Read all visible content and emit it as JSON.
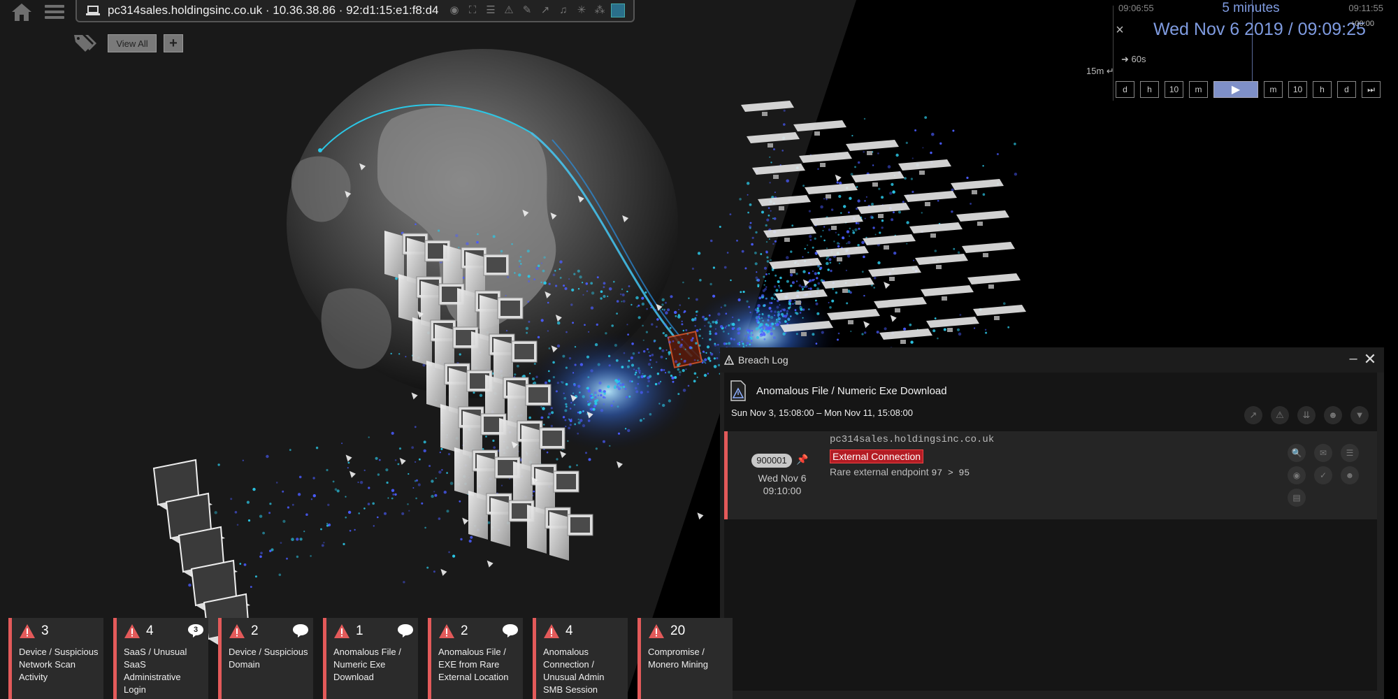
{
  "toolbar": {
    "home_icon": "home-icon",
    "menu_icon": "hamburger-menu-icon",
    "device_icon": "laptop-icon",
    "device_text": "pc314sales.holdingsinc.co.uk · 10.36.38.86 · 92:d1:15:e1:f8:d4",
    "tag_icon": "tag-icon",
    "view_all_label": "View All",
    "add_label": "+"
  },
  "timeline": {
    "range_start": "09:06:55",
    "range_label": "5 minutes",
    "range_end": "09:11:55",
    "close": "×",
    "current_datetime": "Wed Nov 6 2019 / 09:09:25",
    "timezone": "+00:00",
    "step_label": "60s",
    "window_label": "15m",
    "buttons": [
      "d",
      "h",
      "10",
      "m",
      "▶",
      "m",
      "10",
      "h",
      "d",
      "⏭"
    ]
  },
  "breach_log": {
    "title": "Breach Log",
    "minimize": "–",
    "close": "✕",
    "model_name": "Anomalous File / Numeric Exe Download",
    "date_range": "Sun Nov 3, 15:08:00 – Mon Nov 11, 15:08:00",
    "item": {
      "score": "900001",
      "date_line1": "Wed Nov 6",
      "date_line2": "09:10:00",
      "device": "pc314sales.holdingsinc.co.uk",
      "component": "External Connection",
      "detail_prefix": "Rare external endpoint",
      "detail_value": "97 > 95"
    }
  },
  "tiles": [
    {
      "count": "3",
      "label": "Device / Suspicious Network Scan Activity",
      "chat": ""
    },
    {
      "count": "4",
      "label": "SaaS / Unusual SaaS Administrative Login",
      "chat": "3"
    },
    {
      "count": "2",
      "label": "Device / Suspicious Domain",
      "chat": " "
    },
    {
      "count": "1",
      "label": "Anomalous File / Numeric Exe Download",
      "chat": " "
    },
    {
      "count": "2",
      "label": "Anomalous File / EXE from Rare External Location",
      "chat": " "
    },
    {
      "count": "4",
      "label": "Anomalous Connection / Unusual Admin SMB Session",
      "chat": ""
    },
    {
      "count": "20",
      "label": "Compromise / Monero Mining",
      "chat": ""
    }
  ],
  "colors": {
    "alert_red": "#e35a5a",
    "component_red": "#b41c24",
    "timeline_blue": "#7f9be0",
    "connection_cyan": "#2bc7e6",
    "connection_blue": "#4a5cff",
    "model_box_orange": "#e0582a"
  }
}
